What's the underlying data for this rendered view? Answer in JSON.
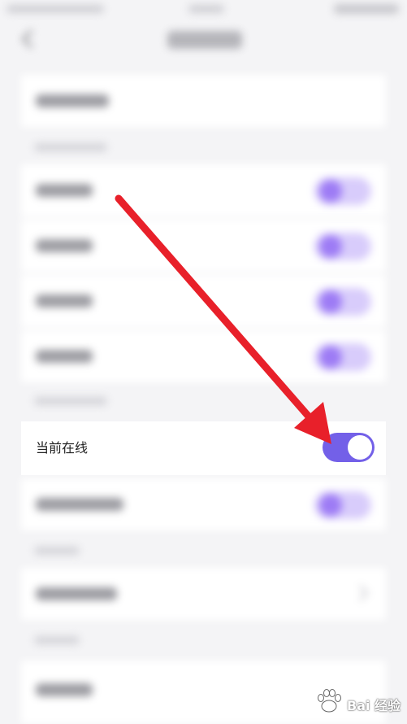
{
  "online_status_row": {
    "label": "当前在线",
    "toggle_on": true
  },
  "watermark": {
    "text": "Bai 经验"
  },
  "colors": {
    "accent": "#7360e8",
    "arrow": "#e8202a",
    "background": "#f4f4f6"
  }
}
